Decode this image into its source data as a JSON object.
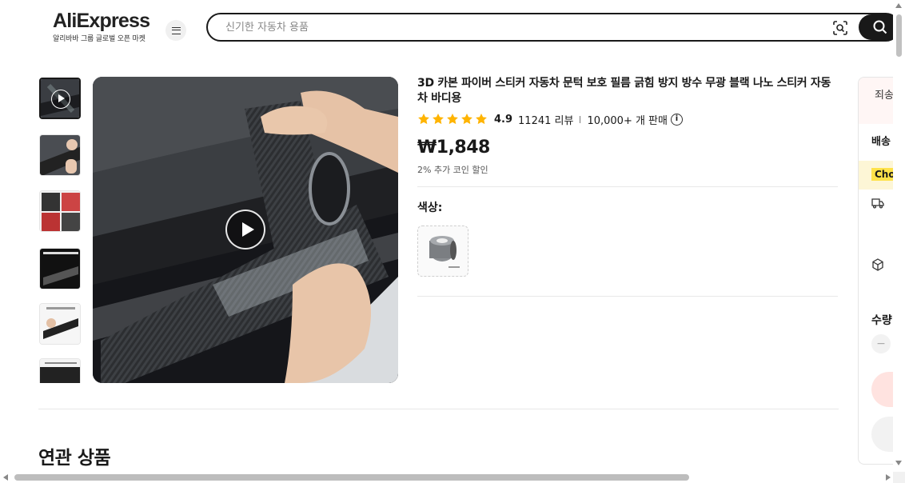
{
  "header": {
    "logo_text": "AliExpress",
    "logo_subtitle": "알리바바 그룹 글로벌 오픈 마켓",
    "menu_icon": "hamburger-menu-icon",
    "search_placeholder": "신기한 자동차 용품",
    "scan_icon": "image-search-icon",
    "search_icon": "search-icon"
  },
  "gallery": {
    "thumbnails": [
      {
        "kind": "video",
        "active": true
      },
      {
        "kind": "image",
        "active": false
      },
      {
        "kind": "image",
        "active": false
      },
      {
        "kind": "image",
        "active": false
      },
      {
        "kind": "image",
        "active": false
      },
      {
        "kind": "image",
        "active": false
      }
    ],
    "main_media": "video",
    "play_icon": "play-icon"
  },
  "product": {
    "title": "3D 카본 파이버 스티커 자동차 문턱 보호 필름 긁힘 방지 방수 무광 블랙 나노 스티커 자동차 바디용",
    "rating": "4.9",
    "stars": 5,
    "review_count": "11241 리뷰",
    "sold": "10,000+ 개 판매",
    "price": "₩1,848",
    "coin_discount": "2% 추가 코인 할인",
    "color_label": "색상:",
    "color_options": [
      {
        "name": "tape-roll",
        "selected": false
      }
    ]
  },
  "side_panel": {
    "top_text": "죄송",
    "shipping_label": "배송",
    "choice_tag": "Cho",
    "quantity_label": "수량",
    "qty_minus": "−"
  },
  "related": {
    "heading": "연관 상품"
  },
  "colors": {
    "star": "#FFB400",
    "search_button": "#191919",
    "choice_tag": "#FFE24A",
    "buy_button": "#FFE3E0"
  }
}
